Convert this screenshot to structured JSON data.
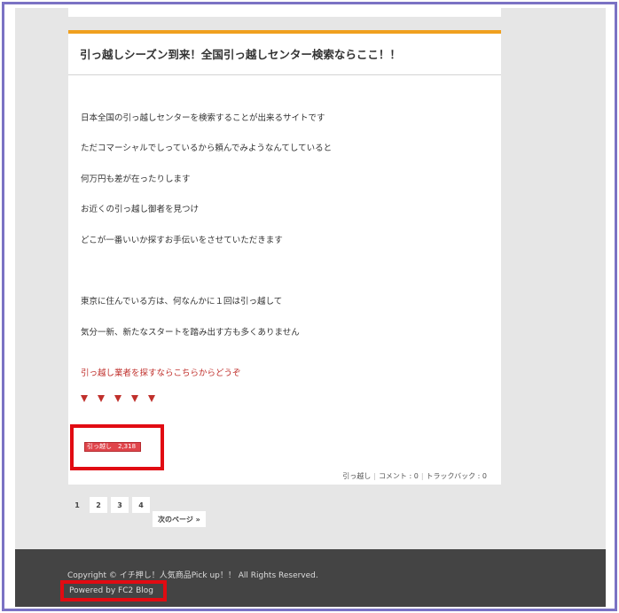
{
  "post": {
    "title": "引っ越しシーズン到来！全国引っ越しセンター検索ならここ！！",
    "lines": [
      "日本全国の引っ越しセンターを検索することが出来るサイトです",
      "ただコマーシャルでしっているから頼んでみようなんてしていると",
      "何万円も差が在ったりします",
      "お近くの引っ越し御者を見つけ",
      "どこが一番いいか探すお手伝いをさせていただきます",
      "東京に住んでいる方は、何なんかに１回は引っ越して",
      "気分一新、新たなスタートを踏み出す方も多くありません"
    ],
    "promo_link": "引っ越し業者を探すならこちらからどうぞ",
    "arrow_count": 5,
    "banner_text": "引っ越し　2,318",
    "meta": {
      "category": "引っ越し",
      "comment": "コメント : 0",
      "trackback": "トラックバック : 0"
    }
  },
  "pager": {
    "pages": [
      "1",
      "2",
      "3",
      "4"
    ],
    "current": "1",
    "next_label": "次のページ »"
  },
  "footer": {
    "copyright": "Copyright © イチ押し！人気商品Pick up！！ All Rights Reserved.",
    "powered": "Powered by FC2 Blog"
  },
  "colors": {
    "accent_orange": "#f0a01e",
    "link_red": "#c0302c",
    "highlight_red": "#e10b12",
    "frame_purple": "#7b72c4",
    "footer_bg": "#444444"
  }
}
